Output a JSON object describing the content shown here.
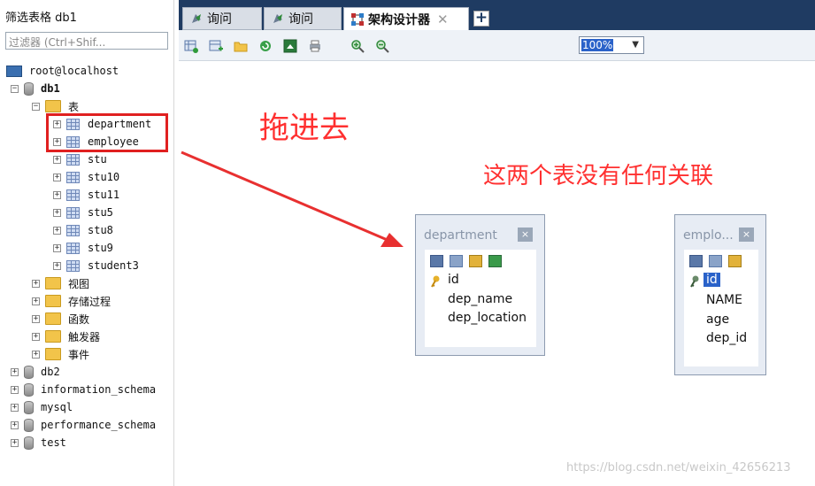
{
  "sidebar": {
    "filter_title": "筛选表格 db1",
    "filter_placeholder": "过滤器 (Ctrl+Shif...",
    "host": "root@localhost",
    "db1": "db1",
    "folder_tables": "表",
    "tables": [
      "department",
      "employee",
      "stu",
      "stu10",
      "stu11",
      "stu5",
      "stu8",
      "stu9",
      "student3"
    ],
    "folders": [
      "视图",
      "存储过程",
      "函数",
      "触发器",
      "事件"
    ],
    "databases": [
      "db2",
      "information_schema",
      "mysql",
      "performance_schema",
      "test"
    ]
  },
  "tabs": [
    {
      "label": "询问"
    },
    {
      "label": "询问"
    },
    {
      "label": "架构设计器",
      "close": "✕"
    }
  ],
  "tab_add": "+",
  "toolbar": {
    "zoom": "100%"
  },
  "annotations": {
    "drag": "拖进去",
    "note": "这两个表没有任何关联"
  },
  "entities": {
    "department": {
      "title": "department",
      "close": "×",
      "fields": [
        "id",
        "dep_name",
        "dep_location"
      ]
    },
    "employee": {
      "title": "emplo...",
      "close": "×",
      "fields": [
        "id",
        "NAME",
        "age",
        "dep_id"
      ]
    }
  },
  "watermark": "https://blog.csdn.net/weixin_42656213",
  "colors": {
    "annotation": "#ff3030",
    "tab_bar": "#1f3b62",
    "selection": "#2a62c9"
  }
}
